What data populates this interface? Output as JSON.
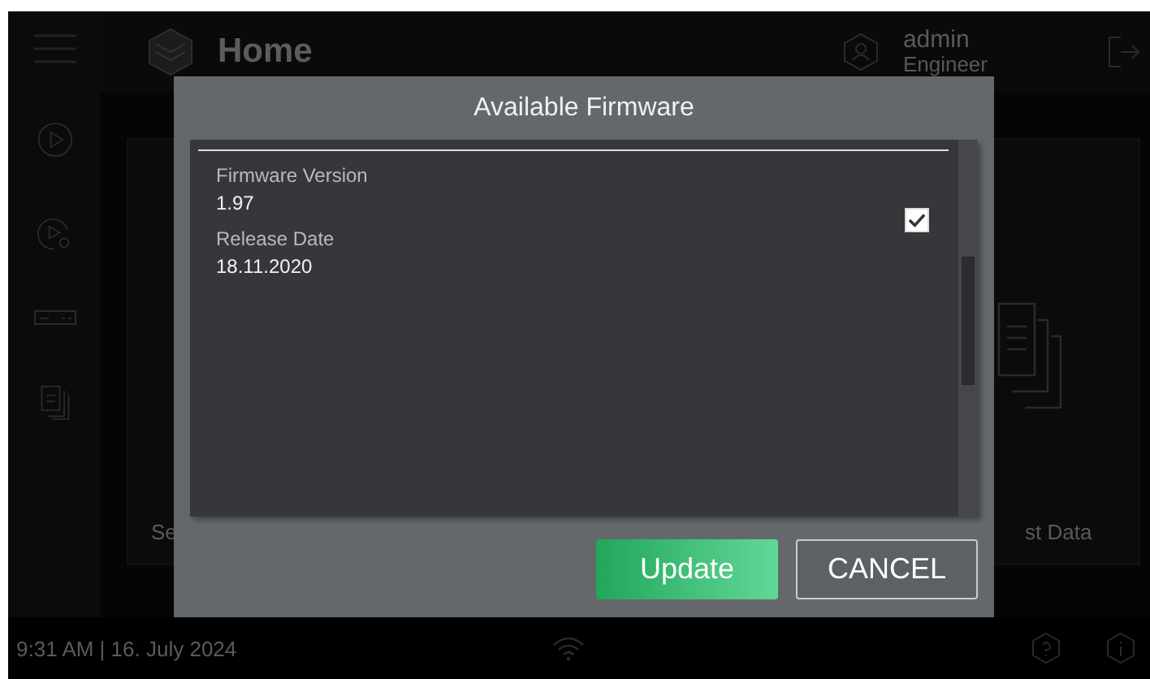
{
  "header": {
    "title": "Home",
    "user": {
      "name": "admin",
      "role": "Engineer"
    }
  },
  "tiles": [
    {
      "label": "Se"
    },
    {
      "label": "st Data"
    }
  ],
  "status_bar": {
    "datetime": "9:31 AM | 16. July 2024"
  },
  "dialog": {
    "title": "Available Firmware",
    "firmware": [
      {
        "fields": [
          {
            "label": "Firmware Version",
            "value": "1.97"
          },
          {
            "label": "Release Date",
            "value": "18.11.2020"
          }
        ],
        "checked": true
      }
    ],
    "buttons": [
      {
        "label": "Update",
        "kind": "primary"
      },
      {
        "label": "CANCEL",
        "kind": "secondary"
      }
    ]
  }
}
